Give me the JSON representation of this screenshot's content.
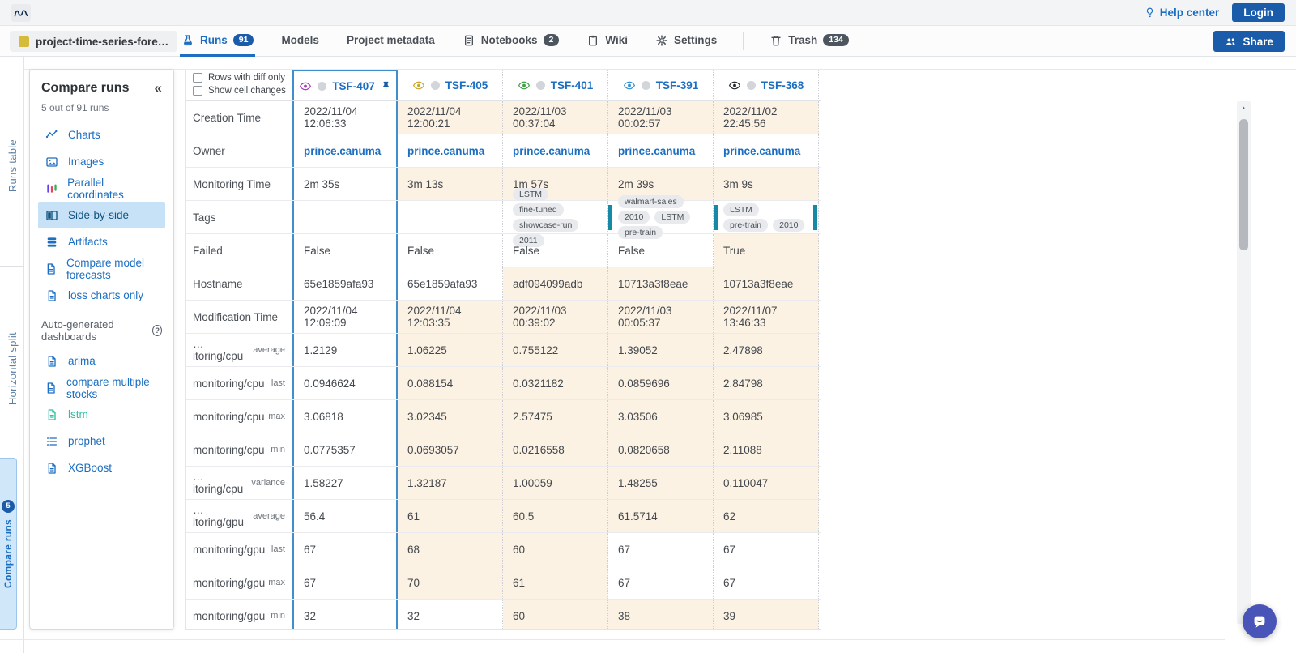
{
  "topbar": {
    "help_center": "Help center",
    "login": "Login"
  },
  "project_bar": {
    "project_name": "project-time-series-fore…",
    "share_label": "Share",
    "tabs": [
      {
        "label": "Runs",
        "icon": "flask",
        "badge": "91",
        "badge_style": "blue",
        "active": true
      },
      {
        "label": "Models"
      },
      {
        "label": "Project metadata"
      },
      {
        "label": "Notebooks",
        "icon": "notebook",
        "badge": "2",
        "badge_style": "dark"
      },
      {
        "label": "Wiki",
        "icon": "clipboard"
      },
      {
        "label": "Settings",
        "icon": "gear"
      },
      {
        "label": "Trash",
        "icon": "trash",
        "badge": "134",
        "badge_style": "dark",
        "divider_before": true
      }
    ]
  },
  "rail": {
    "top_label": "Runs table",
    "middle_label": "Horizontal split",
    "bottom_label": "Compare runs",
    "bottom_badge": "5"
  },
  "sidebar": {
    "title": "Compare runs",
    "subtitle": "5 out of 91 runs",
    "collapse_icon": "«",
    "items": [
      {
        "label": "Charts",
        "icon": "charts"
      },
      {
        "label": "Images",
        "icon": "images"
      },
      {
        "label": "Parallel coordinates",
        "icon": "parallel"
      },
      {
        "label": "Side-by-side",
        "icon": "sidebyside",
        "selected": true
      },
      {
        "label": "Artifacts",
        "icon": "artifacts"
      },
      {
        "label": "Compare model forecasts",
        "icon": "doc"
      },
      {
        "label": "loss charts only",
        "icon": "doc"
      }
    ],
    "section_title": "Auto-generated dashboards",
    "dashboards": [
      {
        "label": "arima",
        "icon": "doc"
      },
      {
        "label": "compare multiple stocks",
        "icon": "doc"
      },
      {
        "label": "lstm",
        "icon": "doc",
        "color": "#2dbfa4"
      },
      {
        "label": "prophet",
        "icon": "list"
      },
      {
        "label": "XGBoost",
        "icon": "doc"
      }
    ]
  },
  "table": {
    "options": [
      "Rows with diff only",
      "Show cell changes"
    ],
    "columns": [
      {
        "id": "TSF-407",
        "eye_color": "#a73cb5",
        "pinned": true
      },
      {
        "id": "TSF-405",
        "eye_color": "#c8a62b"
      },
      {
        "id": "TSF-401",
        "eye_color": "#3fa044"
      },
      {
        "id": "TSF-391",
        "eye_color": "#338fd6"
      },
      {
        "id": "TSF-368",
        "eye_color": "#26292e"
      }
    ],
    "rows": [
      {
        "label": "Creation Time",
        "type": "text",
        "values": [
          "2022/11/04 12:06:33",
          "2022/11/04 12:00:21",
          "2022/11/03 00:37:04",
          "2022/11/03 00:02:57",
          "2022/11/02 22:45:56"
        ],
        "diff": [
          false,
          true,
          true,
          true,
          true
        ]
      },
      {
        "label": "Owner",
        "type": "link",
        "values": [
          "prince.canuma",
          "prince.canuma",
          "prince.canuma",
          "prince.canuma",
          "prince.canuma"
        ],
        "diff": [
          false,
          false,
          false,
          false,
          false
        ]
      },
      {
        "label": "Monitoring Time",
        "type": "text",
        "values": [
          "2m 35s",
          "3m 13s",
          "1m 57s",
          "2m 39s",
          "3m 9s"
        ],
        "diff": [
          false,
          true,
          true,
          true,
          true
        ]
      },
      {
        "label": "Tags",
        "type": "tags",
        "values": [
          [],
          [],
          [
            "LSTM",
            "fine-tuned",
            "showcase-run",
            "2011"
          ],
          [
            "walmart-sales",
            "2010",
            "LSTM",
            "pre-train"
          ],
          [
            "LSTM",
            "pre-train",
            "2010"
          ]
        ],
        "bars": [
          [],
          [],
          [],
          [
            "left"
          ],
          [
            "left",
            "right"
          ]
        ],
        "diff": [
          false,
          false,
          false,
          false,
          false
        ]
      },
      {
        "label": "Failed",
        "type": "text",
        "values": [
          "False",
          "False",
          "False",
          "False",
          "True"
        ],
        "diff": [
          false,
          false,
          false,
          false,
          true
        ]
      },
      {
        "label": "Hostname",
        "type": "text",
        "values": [
          "65e1859afa93",
          "65e1859afa93",
          "adf094099adb",
          "10713a3f8eae",
          "10713a3f8eae"
        ],
        "diff": [
          false,
          false,
          true,
          true,
          true
        ]
      },
      {
        "label": "Modification Time",
        "type": "text",
        "values": [
          "2022/11/04 12:09:09",
          "2022/11/04 12:03:35",
          "2022/11/03 00:39:02",
          "2022/11/03 00:05:37",
          "2022/11/07 13:46:33"
        ],
        "diff": [
          false,
          true,
          true,
          true,
          true
        ]
      },
      {
        "label": "…itoring/cpu",
        "agg": "average",
        "type": "text",
        "values": [
          "1.2129",
          "1.06225",
          "0.755122",
          "1.39052",
          "2.47898"
        ],
        "diff": [
          false,
          true,
          true,
          true,
          true
        ]
      },
      {
        "label": "monitoring/cpu",
        "agg": "last",
        "type": "text",
        "values": [
          "0.0946624",
          "0.088154",
          "0.0321182",
          "0.0859696",
          "2.84798"
        ],
        "diff": [
          false,
          true,
          true,
          true,
          true
        ]
      },
      {
        "label": "monitoring/cpu",
        "agg": "max",
        "type": "text",
        "values": [
          "3.06818",
          "3.02345",
          "2.57475",
          "3.03506",
          "3.06985"
        ],
        "diff": [
          false,
          true,
          true,
          true,
          true
        ]
      },
      {
        "label": "monitoring/cpu",
        "agg": "min",
        "type": "text",
        "values": [
          "0.0775357",
          "0.0693057",
          "0.0216558",
          "0.0820658",
          "2.11088"
        ],
        "diff": [
          false,
          true,
          true,
          true,
          true
        ]
      },
      {
        "label": "…itoring/cpu",
        "agg": "variance",
        "type": "text",
        "values": [
          "1.58227",
          "1.32187",
          "1.00059",
          "1.48255",
          "0.110047"
        ],
        "diff": [
          false,
          true,
          true,
          true,
          true
        ]
      },
      {
        "label": "…itoring/gpu",
        "agg": "average",
        "type": "text",
        "values": [
          "56.4",
          "61",
          "60.5",
          "61.5714",
          "62"
        ],
        "diff": [
          false,
          true,
          true,
          true,
          true
        ]
      },
      {
        "label": "monitoring/gpu",
        "agg": "last",
        "type": "text",
        "values": [
          "67",
          "68",
          "60",
          "67",
          "67"
        ],
        "diff": [
          false,
          true,
          true,
          false,
          false
        ]
      },
      {
        "label": "monitoring/gpu",
        "agg": "max",
        "type": "text",
        "values": [
          "67",
          "70",
          "61",
          "67",
          "67"
        ],
        "diff": [
          false,
          true,
          true,
          false,
          false
        ]
      },
      {
        "label": "monitoring/gpu",
        "agg": "min",
        "type": "text",
        "values": [
          "32",
          "32",
          "60",
          "38",
          "39"
        ],
        "diff": [
          false,
          false,
          true,
          true,
          true
        ]
      }
    ]
  },
  "colors": {
    "accent_blue": "#1b5caa",
    "link_blue": "#1b6ec2",
    "diff_bg": "#fcf2e3",
    "selected_bg": "#c7e2f6",
    "teal": "#2dbfa4",
    "tag_bar_teal": "#1689a6",
    "pinned_border": "#3f8fce"
  }
}
